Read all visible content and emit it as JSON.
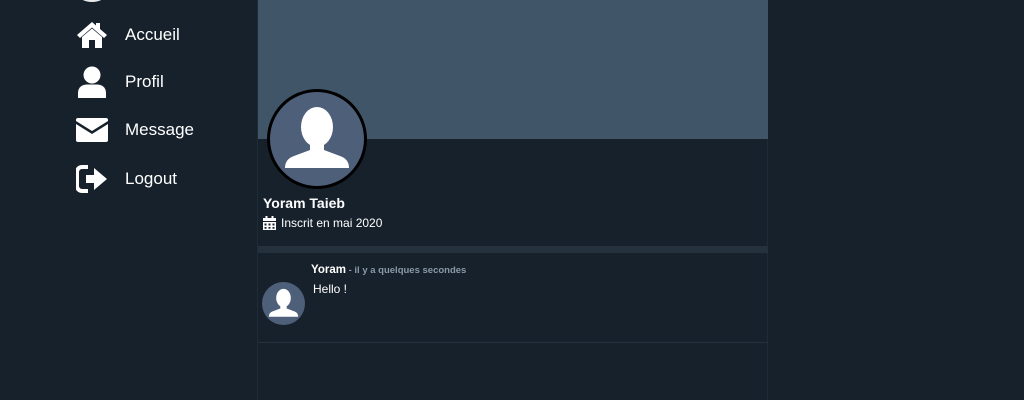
{
  "nav": {
    "items": [
      {
        "label": "Accueil",
        "icon": "home-icon"
      },
      {
        "label": "Profil",
        "icon": "user-icon"
      },
      {
        "label": "Message",
        "icon": "envelope-icon"
      },
      {
        "label": "Logout",
        "icon": "logout-icon"
      }
    ]
  },
  "profile": {
    "name": "Yoram Taieb",
    "joined": "Inscrit en mai 2020",
    "banner_color": "#405567",
    "avatar_color": "#4e5f7a"
  },
  "tweet": {
    "author": "Yoram",
    "separator": " - ",
    "time": "il y a quelques secondes",
    "text": "Hello !"
  },
  "colors": {
    "background": "#17212b",
    "divider": "#25313d",
    "muted_text": "#8a99a8"
  }
}
